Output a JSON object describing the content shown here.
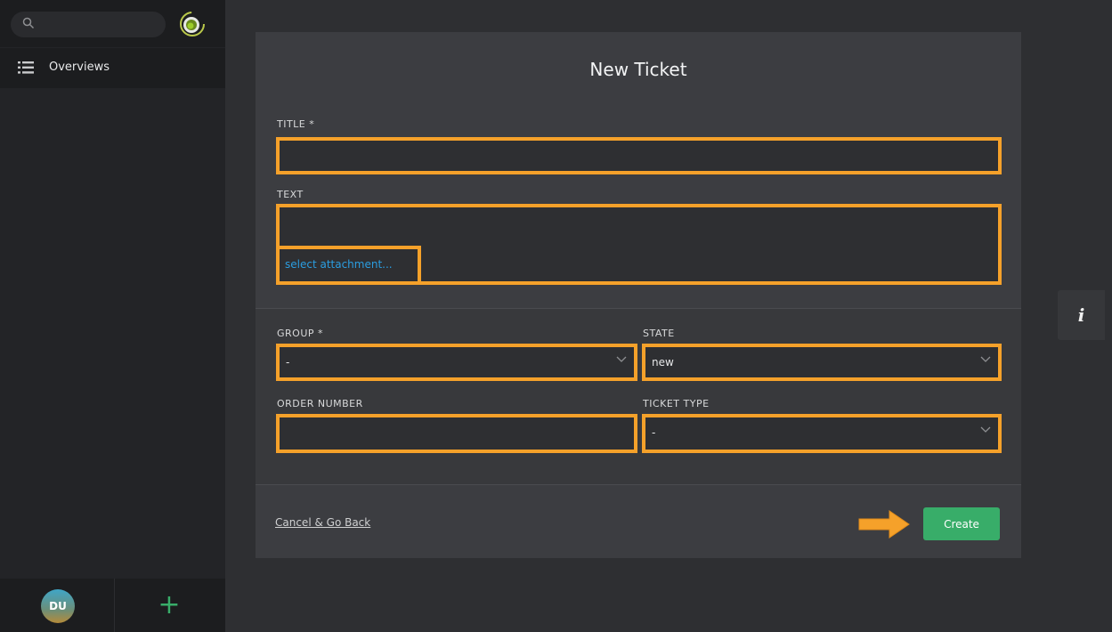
{
  "sidebar": {
    "search_placeholder": "",
    "nav": [
      {
        "label": "Overviews",
        "icon": "list-icon"
      }
    ],
    "user_initials": "DU",
    "add_label": "+"
  },
  "form": {
    "title": "New Ticket",
    "fields": {
      "title_label": "TITLE *",
      "title_value": "",
      "text_label": "TEXT",
      "attachment_link": "select attachment...",
      "group_label": "GROUP *",
      "group_value": "-",
      "state_label": "STATE",
      "state_value": "new",
      "order_label": "ORDER NUMBER",
      "order_value": "",
      "type_label": "TICKET TYPE",
      "type_value": "-"
    },
    "cancel_label": "Cancel & Go Back",
    "create_label": "Create"
  },
  "info_button_label": "i",
  "colors": {
    "accent_green": "#38ad69",
    "highlight_orange": "#f5a12a",
    "link_blue": "#2b9de0"
  }
}
